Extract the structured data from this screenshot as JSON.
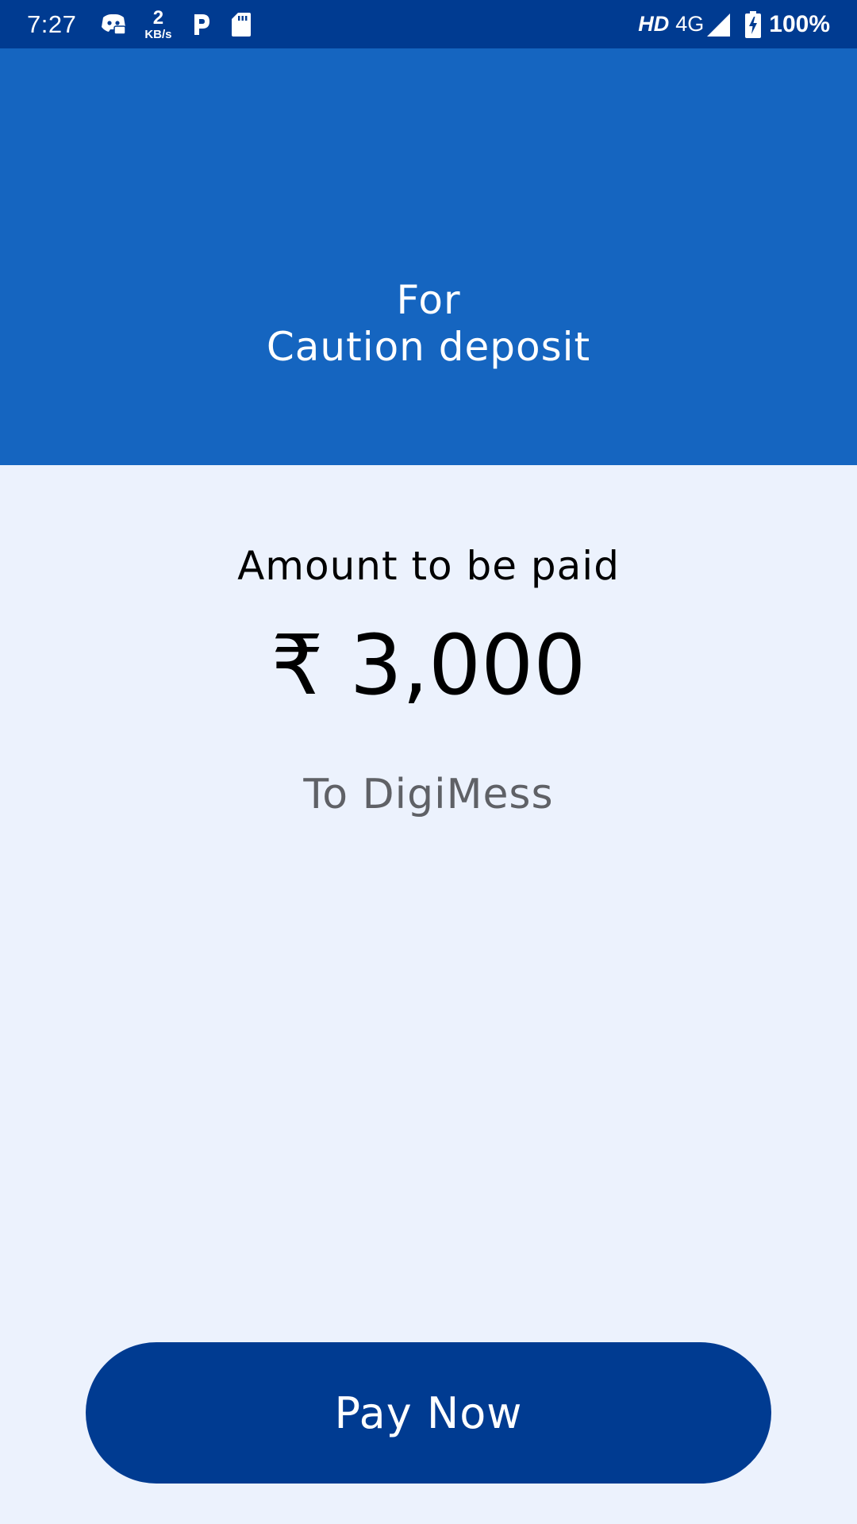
{
  "status_bar": {
    "time": "7:27",
    "net_speed_value": "2",
    "net_speed_unit": "KB/s",
    "hd_label": "HD",
    "network_type": "4G",
    "battery": "100%",
    "icons": [
      "discord-icon",
      "paytm-icon",
      "sd-card-icon",
      "signal-icon",
      "battery-charging-icon"
    ]
  },
  "header": {
    "line1": "For",
    "line2": "Caution deposit"
  },
  "payment": {
    "amount_label": "Amount to be paid",
    "amount": "₹ 3,000",
    "payee": "To DigiMess"
  },
  "actions": {
    "pay_label": "Pay Now"
  },
  "colors": {
    "status_bar": "#003B91",
    "header": "#1565C0",
    "background": "#ECF2FD",
    "button": "#003B91",
    "payee_text": "#5F6166"
  }
}
